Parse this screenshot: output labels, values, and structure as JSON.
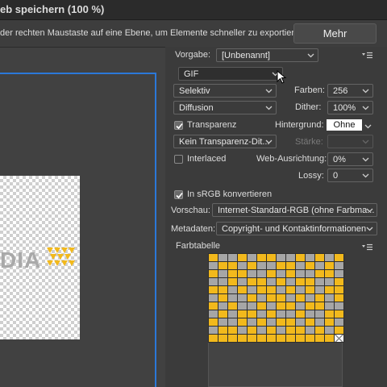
{
  "window": {
    "title": "eb speichern (100 %)"
  },
  "hint": "der rechten Maustaste auf eine Ebene, um Elemente schneller zu exportieren",
  "more_button": "Mehr",
  "preview": {
    "logo_text": "DIA"
  },
  "settings": {
    "preset_label": "Vorgabe:",
    "preset_value": "[Unbenannt]",
    "format_value": "GIF",
    "reduction_value": "Selektiv",
    "colors_label": "Farben:",
    "colors_value": "256",
    "dither_method": "Diffusion",
    "dither_label": "Dither:",
    "dither_value": "100%",
    "transparency_label": "Transparenz",
    "transparency_checked": true,
    "matte_label": "Hintergrund:",
    "matte_value": "Ohne",
    "transparency_dither": "Kein Transparenz-Dit...",
    "amount_label": "Stärke:",
    "interlaced_label": "Interlaced",
    "interlaced_checked": false,
    "web_snap_label": "Web-Ausrichtung:",
    "web_snap_value": "0%",
    "lossy_label": "Lossy:",
    "lossy_value": "0",
    "srgb_label": "In sRGB konvertieren",
    "srgb_checked": true,
    "preview_label": "Vorschau:",
    "preview_value": "Internet-Standard-RGB (ohne Farbma...",
    "metadata_label": "Metadaten:",
    "metadata_value": "Copyright- und Kontaktinformationen",
    "color_table_label": "Farbtabelle"
  },
  "colors": {
    "yellow": "#f2b91c",
    "gray": "#a6a6a6",
    "accent": "#2b78d8"
  },
  "color_table": [
    "YGGYGYYGGYGYGY",
    "GYYGYGGYYGYGYG",
    "YGYYGGYGYGGYYG",
    "GGYGYYGYGYYGGY",
    "YYGYGYYGYGYGYY",
    "GYGGYGYYGYGYGY",
    "YGYGGYGYYGYYGG",
    "GYGYYGYGGYGGYY",
    "YGGYGYGYYGYGYG",
    "GYYGYGYGYYGYGY",
    "YYYYYYYYYYYYYT"
  ]
}
